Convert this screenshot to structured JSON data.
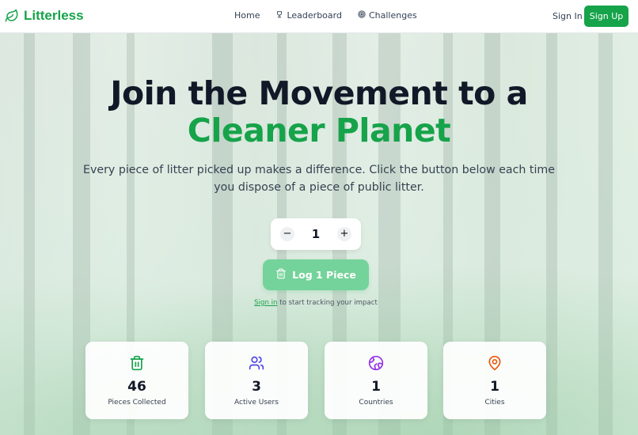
{
  "brand": {
    "name": "Litterless",
    "icon": "leaf-icon",
    "color": "#16a34a"
  },
  "nav": {
    "links": [
      {
        "label": "Home",
        "icon": ""
      },
      {
        "label": "Leaderboard",
        "icon": "trophy-icon"
      },
      {
        "label": "Challenges",
        "icon": "target-icon"
      }
    ],
    "signin_label": "Sign In",
    "signup_label": "Sign Up"
  },
  "hero": {
    "title_line1": "Join the Movement to a",
    "title_line2": "Cleaner Planet",
    "subtitle": "Every piece of litter picked up makes a difference. Click the button below each time you dispose of a piece of public litter."
  },
  "counter": {
    "decrement": "−",
    "value": "1",
    "increment": "+"
  },
  "log_button": {
    "label": "Log 1 Piece",
    "icon": "trash-icon"
  },
  "signin_hint": {
    "link": "Sign in",
    "text": " to start tracking your impact"
  },
  "stats": [
    {
      "value": "46",
      "label": "Pieces Collected",
      "icon": "trash-icon",
      "color": "#16a34a"
    },
    {
      "value": "3",
      "label": "Active Users",
      "icon": "users-icon",
      "color": "#4f46e5"
    },
    {
      "value": "1",
      "label": "Countries",
      "icon": "globe-icon",
      "color": "#9333ea"
    },
    {
      "value": "1",
      "label": "Cities",
      "icon": "map-pin-icon",
      "color": "#ea580c"
    }
  ]
}
